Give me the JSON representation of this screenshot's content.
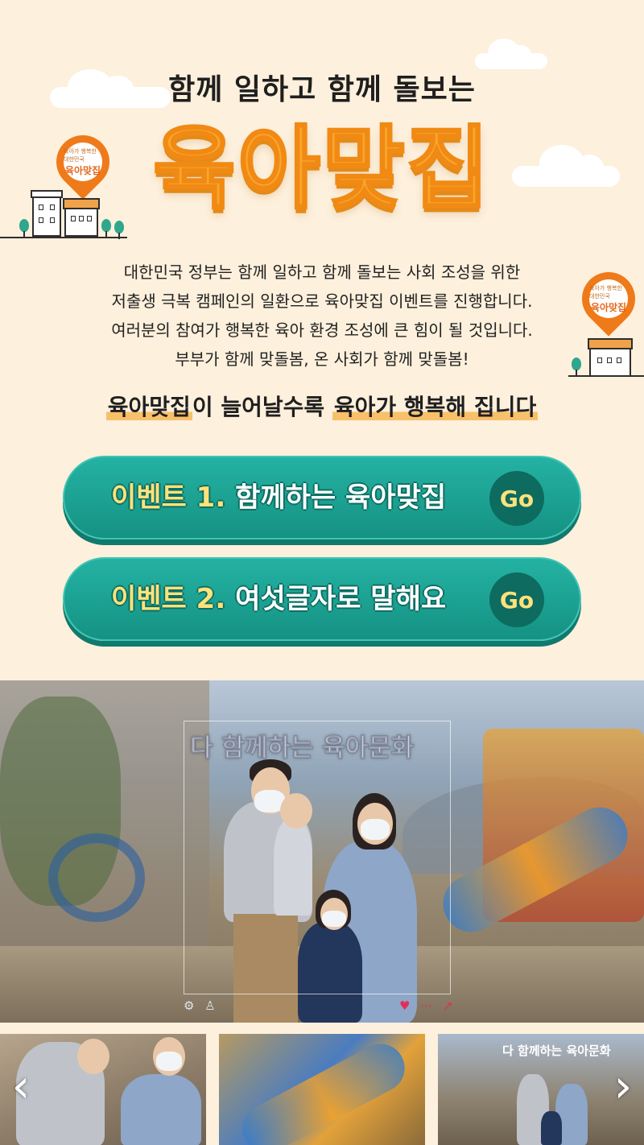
{
  "header": {
    "subtitle": "함께 일하고 함께 돌보는",
    "logo_text": "육아맞집",
    "pin_small": "육아가 행복한 대한민국",
    "pin_big": "육아맞집"
  },
  "intro": {
    "lines": [
      "대한민국 정부는 함께 일하고 함께 돌보는 사회 조성을 위한",
      "저출생 극복 캠페인의 일환으로 육아맞집 이벤트를 진행합니다.",
      "여러분의 참여가 행복한 육아 환경 조성에 큰 힘이 될 것입니다.",
      "부부가 함께 맞돌봄, 온 사회가 함께 맞돌봄!"
    ]
  },
  "tagline": {
    "part1": "육아맞집",
    "part2": "이 늘어날수록 ",
    "part3": "육아가 행복해 집니다"
  },
  "events": [
    {
      "num": "이벤트 1.",
      "title": "함께하는 육아맞집",
      "go": "Go"
    },
    {
      "num": "이벤트 2.",
      "title": "여섯글자로 말해요",
      "go": "Go"
    }
  ],
  "video": {
    "caption": "다 함께하는 육아문화",
    "icons_left": "⚙ ♙",
    "icons_right": "♥ ⋯ ↗"
  },
  "thumbnails": {
    "caption_3": "다 함께하는 육아문화",
    "prev": "‹",
    "next": "›"
  },
  "colors": {
    "background": "#fdf0dc",
    "logo_orange": "#f9a62a",
    "button_teal": "#1aa293",
    "go_yellow": "#ffe27a"
  }
}
